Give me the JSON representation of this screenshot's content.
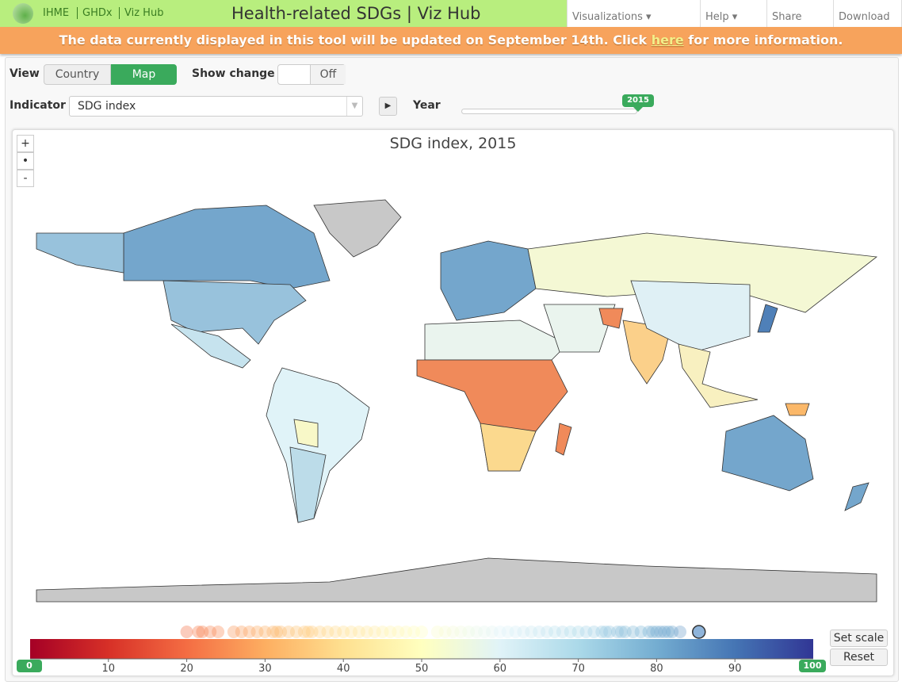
{
  "header": {
    "brand_links": [
      "IHME",
      "GHDx",
      "Viz Hub"
    ],
    "title": "Health-related SDGs | Viz Hub",
    "nav": [
      "Visualizations ▾",
      "Help ▾",
      "Share",
      "Download"
    ]
  },
  "banner": {
    "before": "The data currently displayed in this tool will be updated on September 14th. Click ",
    "link": "here",
    "after": " for more information."
  },
  "controls": {
    "view_label": "View",
    "view_options": [
      "Country",
      "Map"
    ],
    "view_selected": "Map",
    "show_change_label": "Show change",
    "show_change_value": "Off",
    "indicator_label": "Indicator",
    "indicator_value": "SDG index",
    "play_icon": "▶",
    "year_label": "Year",
    "year_value": "2015"
  },
  "map": {
    "title": "SDG index, 2015",
    "zoom_in": "+",
    "zoom_reset": "•",
    "zoom_out": "-",
    "no_data_color": "#c8c8c8"
  },
  "legend": {
    "ticks": [
      "10",
      "20",
      "30",
      "40",
      "50",
      "60",
      "70",
      "80",
      "90"
    ],
    "min": "0",
    "max": "100",
    "set_scale": "Set scale",
    "reset": "Reset",
    "selected_value": 85.4,
    "colors": [
      "#a50026",
      "#d73027",
      "#f46d43",
      "#fdae61",
      "#fee090",
      "#ffffbf",
      "#e0f3f8",
      "#abd9e9",
      "#74add1",
      "#4575b4",
      "#313695"
    ],
    "country_values": [
      20,
      21.5,
      22,
      23,
      24,
      26,
      27,
      28,
      29,
      30,
      31,
      31.5,
      32,
      33,
      34,
      35,
      35.5,
      36,
      37,
      38,
      39,
      40,
      41,
      42,
      43,
      44,
      45,
      46,
      47,
      48,
      49,
      50,
      52,
      53,
      54,
      55,
      56,
      57,
      58,
      59,
      60,
      61,
      62,
      63,
      64,
      65,
      66,
      67,
      68,
      69,
      70,
      71,
      72,
      73,
      73.5,
      74,
      75,
      75.5,
      76,
      77,
      78,
      79,
      79.5,
      80,
      80.5,
      81,
      81.5,
      82,
      83
    ]
  }
}
